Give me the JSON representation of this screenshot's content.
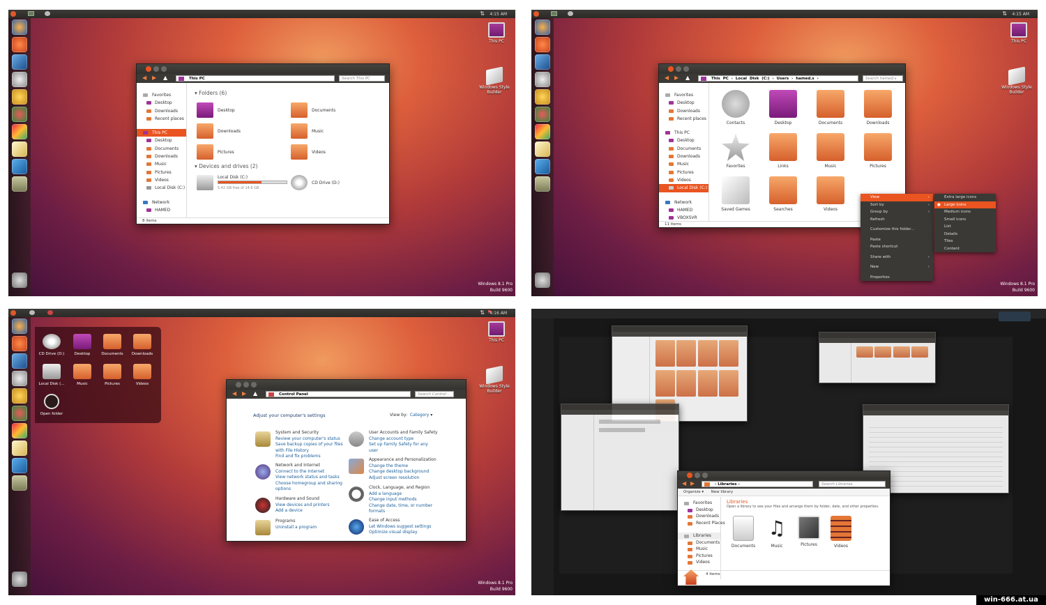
{
  "desktop": {
    "this_pc": "This PC",
    "wsb": "Windows Style Builder",
    "os_name": "Windows 8.1 Pro",
    "os_build": "Build 9600",
    "time1": "4:15 AM",
    "time2": "4:15 AM",
    "time3": "4:16 AM"
  },
  "win1": {
    "address": "This PC",
    "search": "Search This PC",
    "sidebar": [
      "Favorites",
      "Desktop",
      "Downloads",
      "Recent places",
      "This PC",
      "Desktop",
      "Documents",
      "Downloads",
      "Music",
      "Pictures",
      "Videos",
      "Local Disk (C:)",
      "Network",
      "HAMED"
    ],
    "folders_header": "Folders (6)",
    "folders": [
      "Desktop",
      "Documents",
      "Downloads",
      "Music",
      "Pictures",
      "Videos"
    ],
    "devices_header": "Devices and drives (2)",
    "disk_name": "Local Disk (C:)",
    "disk_free": "5.42 GB free of 14.6 GB",
    "disk_used_fraction": 0.63,
    "cd_name": "CD Drive (D:)",
    "status": "8 items"
  },
  "win2": {
    "address": [
      "This PC",
      "Local Disk (C:)",
      "Users",
      "hamed.s"
    ],
    "search": "Search hamed.s",
    "sidebar": [
      "Favorites",
      "Desktop",
      "Downloads",
      "Recent places",
      "This PC",
      "Desktop",
      "Documents",
      "Downloads",
      "Music",
      "Pictures",
      "Videos",
      "Local Disk (C:)",
      "Network",
      "HAMED",
      "VBOXSVR"
    ],
    "items": [
      "Contacts",
      "Desktop",
      "Documents",
      "Downloads",
      "Favorites",
      "Links",
      "Music",
      "Pictures",
      "Saved Games",
      "Searches",
      "Videos"
    ],
    "status": "11 items",
    "context_menu": [
      "View",
      "Sort by",
      "Group by",
      "Refresh",
      "Customize this folder...",
      "Paste",
      "Paste shortcut",
      "Share with",
      "New",
      "Properties"
    ],
    "submenu": [
      "Extra large icons",
      "Large icons",
      "Medium icons",
      "Small icons",
      "List",
      "Details",
      "Tiles",
      "Content"
    ]
  },
  "dash": {
    "items": [
      "CD Drive (D:)",
      "Desktop",
      "Documents",
      "Downloads",
      "Local Disk (...",
      "Music",
      "Pictures",
      "Videos",
      "Open folder"
    ]
  },
  "control_panel": {
    "address": "Control Panel",
    "search": "Search Control...",
    "heading": "Adjust your computer's settings",
    "view_by_label": "View by:",
    "view_by_value": "Category",
    "left": [
      {
        "title": "System and Security",
        "links": [
          "Review your computer's status",
          "Save backup copies of your files",
          "with File History",
          "Find and fix problems"
        ]
      },
      {
        "title": "Network and Internet",
        "links": [
          "Connect to the Internet",
          "View network status and tasks",
          "Choose homegroup and sharing",
          "options"
        ]
      },
      {
        "title": "Hardware and Sound",
        "links": [
          "View devices and printers",
          "Add a device"
        ]
      },
      {
        "title": "Programs",
        "links": [
          "Uninstall a program"
        ]
      }
    ],
    "right": [
      {
        "title": "User Accounts and Family Safety",
        "links": [
          "Change account type",
          "Set up Family Safety for any",
          "user"
        ]
      },
      {
        "title": "Appearance and Personalization",
        "links": [
          "Change the theme",
          "Change desktop background",
          "Adjust screen resolution"
        ]
      },
      {
        "title": "Clock, Language, and Region",
        "links": [
          "Add a language",
          "Change input methods",
          "Change date, time, or number",
          "formats"
        ]
      },
      {
        "title": "Ease of Access",
        "links": [
          "Let Windows suggest settings",
          "Optimize visual display"
        ]
      }
    ]
  },
  "libraries": {
    "address": "Libraries",
    "search": "Search Libraries",
    "organize": "Organize",
    "new_library": "New library",
    "title": "Libraries",
    "desc": "Open a library to see your files and arrange them by folder, date, and other properties.",
    "sidebar": [
      "Favorites",
      "Desktop",
      "Downloads",
      "Recent Places",
      "Libraries",
      "Documents",
      "Music",
      "Pictures",
      "Videos"
    ],
    "items": [
      "Documents",
      "Music",
      "Pictures",
      "Videos"
    ],
    "status": "4 items"
  },
  "watermark": "win-666.at.ua"
}
